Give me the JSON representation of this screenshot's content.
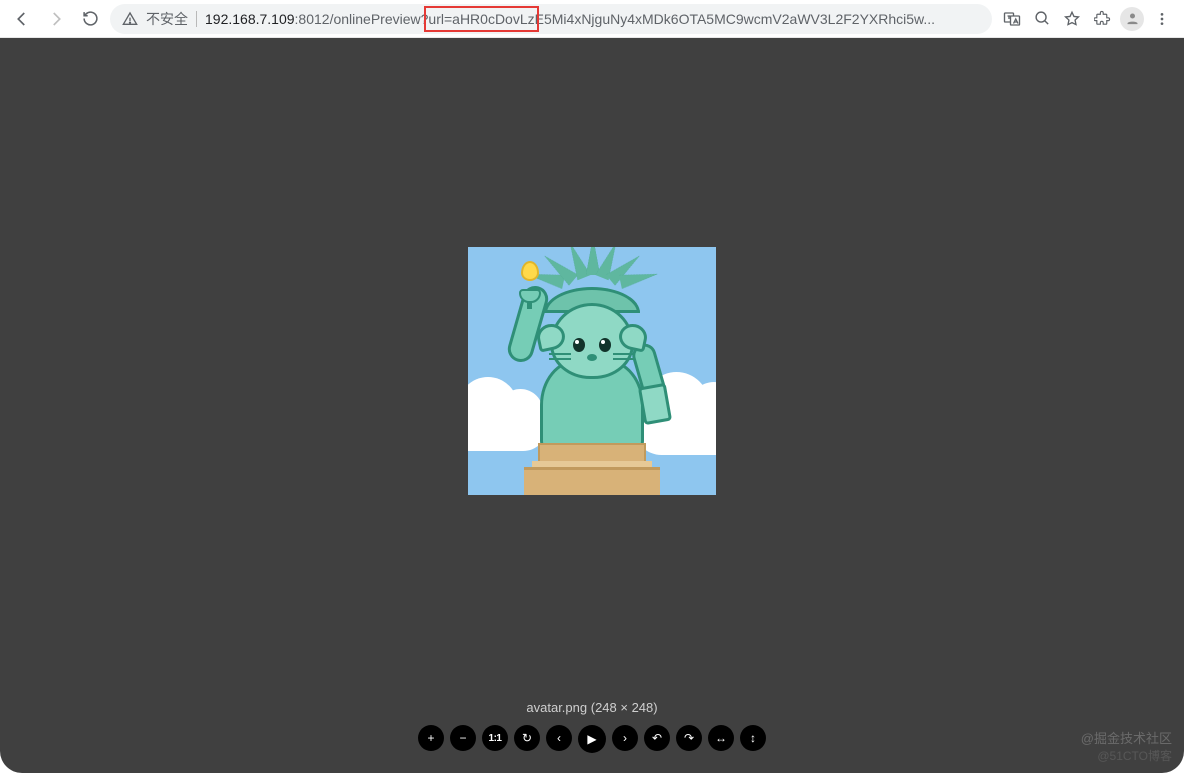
{
  "browser": {
    "insecure_label": "不安全",
    "url_host": "192.168.7.109",
    "url_port": ":8012",
    "url_path_before": "/onlinePreview?",
    "url_highlight": "url=aHR0cDovLz",
    "url_path_after": "E5Mi4xNjguNy4xMDk6OTA5MC9wcmV2aWV3L2F2YXRhci5w...",
    "icons": {
      "back": "back-icon",
      "forward": "forward-icon",
      "reload": "reload-icon",
      "warning": "warning-icon",
      "translate": "translate-icon",
      "zoom": "zoom-icon",
      "star": "star-icon",
      "extensions": "extensions-icon",
      "profile": "profile-icon",
      "menu": "menu-icon"
    }
  },
  "viewer": {
    "filename": "avatar.png",
    "dimensions": "(248 × 248)",
    "toolbar": {
      "zoom_in": "+",
      "zoom_out": "−",
      "actual_size": "1:1",
      "rotate": "↻",
      "prev": "‹",
      "play": "▶",
      "next": "›",
      "undo": "↶",
      "redo": "↷",
      "flip_h": "↔",
      "flip_v": "↕"
    }
  },
  "watermark": {
    "line1": "@掘金技术社区",
    "line2": "@51CTO博客"
  }
}
